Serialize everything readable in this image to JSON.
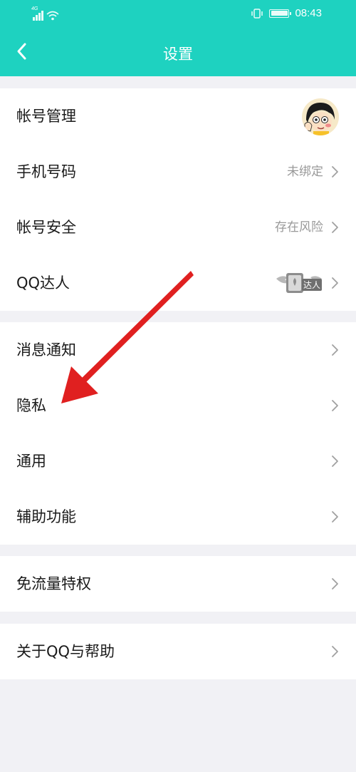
{
  "status_bar": {
    "signal_tiny": "4G",
    "time": "08:43"
  },
  "header": {
    "title": "设置"
  },
  "groups": [
    {
      "items": [
        {
          "label": "帐号管理",
          "value": ""
        },
        {
          "label": "手机号码",
          "value": "未绑定"
        },
        {
          "label": "帐号安全",
          "value": "存在风险"
        },
        {
          "label": "QQ达人",
          "value": ""
        }
      ]
    },
    {
      "items": [
        {
          "label": "消息通知",
          "value": ""
        },
        {
          "label": "隐私",
          "value": ""
        },
        {
          "label": "通用",
          "value": ""
        },
        {
          "label": "辅助功能",
          "value": ""
        }
      ]
    },
    {
      "items": [
        {
          "label": "免流量特权",
          "value": ""
        }
      ]
    },
    {
      "items": [
        {
          "label": "关于QQ与帮助",
          "value": ""
        }
      ]
    }
  ],
  "badges": {
    "daren_label": "达人"
  },
  "colors": {
    "header_bg": "#1ed2c0",
    "page_bg": "#f1f1f5",
    "annotation_arrow": "#e02020",
    "secondary_text": "#999999"
  },
  "icons": {
    "back": "chevron-left-icon",
    "row_chevron": "chevron-right-icon",
    "annotation": "red-arrow-annotation"
  }
}
